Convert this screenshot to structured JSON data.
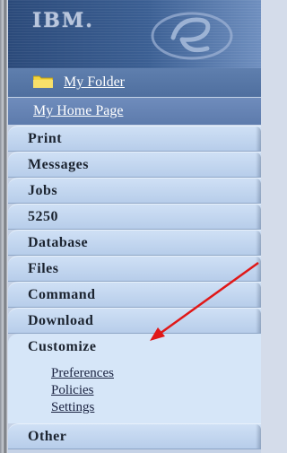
{
  "header": {
    "logo_text": "IBM."
  },
  "nav": {
    "my_folder": "My Folder",
    "my_home_page": "My Home Page",
    "tabs": [
      "Print",
      "Messages",
      "Jobs",
      "5250",
      "Database",
      "Files",
      "Command",
      "Download"
    ],
    "customize": {
      "label": "Customize",
      "items": [
        "Preferences",
        "Policies",
        "Settings"
      ]
    },
    "other": "Other"
  },
  "colors": {
    "annotation_arrow": "#e01818"
  },
  "icons": [
    "folder-icon",
    "eserver-logo-icon",
    "red-arrow-annotation"
  ]
}
